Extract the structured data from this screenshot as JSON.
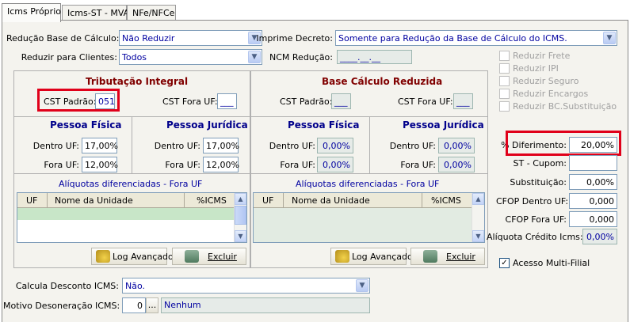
{
  "tabs": [
    "Icms Próprio",
    "Icms-ST - MVA",
    "NFe/NFCe"
  ],
  "top": {
    "reducao_label": "Redução Base de Cálculo:",
    "reducao_value": "Não Reduzir",
    "reduzir_clientes_label": "Reduzir para Clientes:",
    "reduzir_clientes_value": "Todos",
    "imprime_decreto_label": "Imprime Decreto:",
    "imprime_decreto_value": "Somente para Redução da Base de Cálculo do ICMS.",
    "ncm_reducao_label": "NCM Redução:",
    "ncm_reducao_value": "____.__.__"
  },
  "tributacao": {
    "title": "Tributação Integral",
    "cst_padrao_label": "CST Padrão:",
    "cst_padrao_value": "051",
    "cst_fora_uf_label": "CST Fora UF:",
    "cst_fora_uf_value": "___",
    "pf_title": "Pessoa Física",
    "pj_title": "Pessoa Jurídica",
    "dentro_uf_label": "Dentro UF:",
    "fora_uf_label": "Fora UF:",
    "pf_dentro": "17,00%",
    "pf_fora": "12,00%",
    "pj_dentro": "17,00%",
    "pj_fora": "12,00%",
    "aliquotas_title": "Alíquotas diferenciadas - Fora UF",
    "col_uf": "UF",
    "col_nome": "Nome da Unidade",
    "col_icms": "%ICMS",
    "log_btn": "Log Avançado",
    "excluir_btn": "Excluir"
  },
  "reduzida": {
    "title": "Base Cálculo Reduzida",
    "cst_padrao_label": "CST Padrão:",
    "cst_padrao_value": "___",
    "cst_fora_uf_label": "CST Fora UF:",
    "cst_fora_uf_value": "___",
    "pf_title": "Pessoa Física",
    "pj_title": "Pessoa Jurídica",
    "dentro_uf_label": "Dentro UF:",
    "fora_uf_label": "Fora UF:",
    "pf_dentro": "0,00%",
    "pf_fora": "0,00%",
    "pj_dentro": "0,00%",
    "pj_fora": "0,00%",
    "aliquotas_title": "Alíquotas diferenciadas - Fora UF",
    "col_uf": "UF",
    "col_nome": "Nome da Unidade",
    "col_icms": "%ICMS",
    "log_btn": "Log Avançado",
    "excluir_btn": "Excluir"
  },
  "right": {
    "checks": [
      "Reduzir Frete",
      "Reduzir IPI",
      "Reduzir Seguro",
      "Reduzir Encargos",
      "Reduzir BC.Substituição"
    ],
    "diferimento_label": "% Diferimento:",
    "diferimento_value": "20,00%",
    "st_cupom_label": "ST - Cupom:",
    "st_cupom_value": "",
    "substituicao_label": "Substituição:",
    "substituicao_value": "0,00%",
    "cfop_dentro_label": "CFOP Dentro UF:",
    "cfop_dentro_value": "0,000",
    "cfop_fora_label": "CFOP Fora UF:",
    "cfop_fora_value": "0,000",
    "aliquota_credito_label": "Alíquota Crédito Icms:",
    "aliquota_credito_value": "0,00%",
    "acesso_label": "Acesso Multi-Filial"
  },
  "bottom": {
    "calcula_label": "Calcula Desconto ICMS:",
    "calcula_value": "Não.",
    "motivo_label": "Motivo Desoneração ICMS:",
    "motivo_code": "0",
    "motivo_btn": "...",
    "motivo_desc": "Nenhum"
  },
  "colors": {
    "highlight": "#e0001a",
    "title_red": "#800000",
    "title_blue": "#00008b",
    "value_blue": "#0000a0"
  }
}
